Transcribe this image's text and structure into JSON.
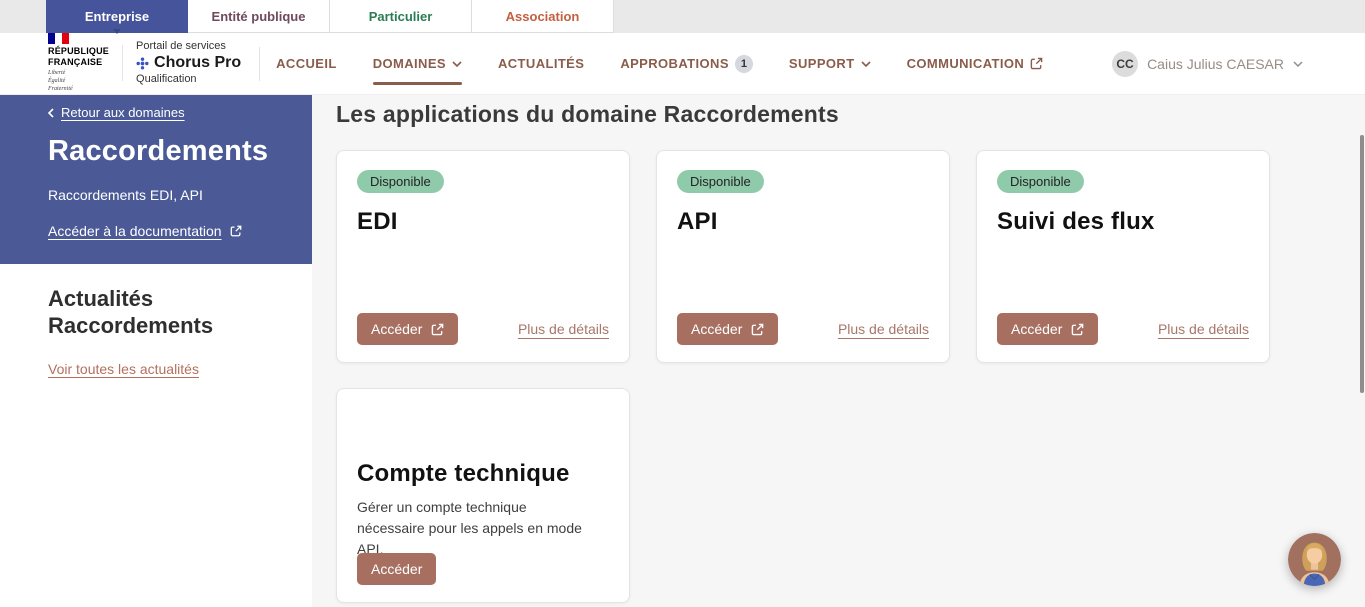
{
  "profile_bar": {
    "tabs": [
      {
        "label": "Entreprise",
        "active": true,
        "bg": "#45549b",
        "color": "#ffffff"
      },
      {
        "label": "Entité publique",
        "color": "#6f4a5c"
      },
      {
        "label": "Particulier",
        "color": "#2a7d54"
      },
      {
        "label": "Association",
        "color": "#c4603f"
      }
    ]
  },
  "header": {
    "brand": {
      "republique_line1": "RÉPUBLIQUE",
      "republique_line2": "FRANÇAISE",
      "motto_line1": "Liberté",
      "motto_line2": "Égalité",
      "motto_line3": "Fraternité",
      "portal_label": "Portail de services",
      "product_name": "Chorus Pro",
      "environment": "Qualification"
    },
    "nav": [
      {
        "label": "ACCUEIL"
      },
      {
        "label": "DOMAINES",
        "has_chevron": true,
        "active": true
      },
      {
        "label": "ACTUALITÉS"
      },
      {
        "label": "APPROBATIONS",
        "badge": "1"
      },
      {
        "label": "SUPPORT",
        "has_chevron": true
      },
      {
        "label": "COMMUNICATION",
        "external_link": true
      }
    ],
    "user": {
      "initials": "CC",
      "name": "Caius Julius CAESAR"
    }
  },
  "sidebar": {
    "back_link": "Retour aux domaines",
    "title": "Raccordements",
    "subtitle": "Raccordements EDI, API",
    "doc_link": "Accéder à la documentation",
    "news_title_line1": "Actualités",
    "news_title_line2": "Raccordements",
    "news_link": "Voir toutes les actualités"
  },
  "main": {
    "title": "Les applications du domaine Raccordements",
    "cards": [
      {
        "status": "Disponible",
        "title": "EDI",
        "button_label": "Accéder",
        "details_label": "Plus de détails"
      },
      {
        "status": "Disponible",
        "title": "API",
        "button_label": "Accéder",
        "details_label": "Plus de détails"
      },
      {
        "status": "Disponible",
        "title": "Suivi des flux",
        "button_label": "Accéder",
        "details_label": "Plus de détails"
      },
      {
        "title": "Compte technique",
        "description": "Gérer un compte technique nécessaire pour les appels en mode API.",
        "button_label": "Accéder"
      }
    ]
  },
  "colors": {
    "active_tab_blue": "#45549b",
    "sidebar_blue": "#4b5a96",
    "nav_brown": "#8a5c4c",
    "button_brown": "#a76f60",
    "badge_green": "#8fcbaa",
    "page_background": "#f6f6f6"
  },
  "icons": {
    "external_link": "external-link-icon",
    "chevron_down": "chevron-down-icon",
    "chevron_left": "chevron-left-icon",
    "assistant": "assistant-avatar-icon"
  }
}
